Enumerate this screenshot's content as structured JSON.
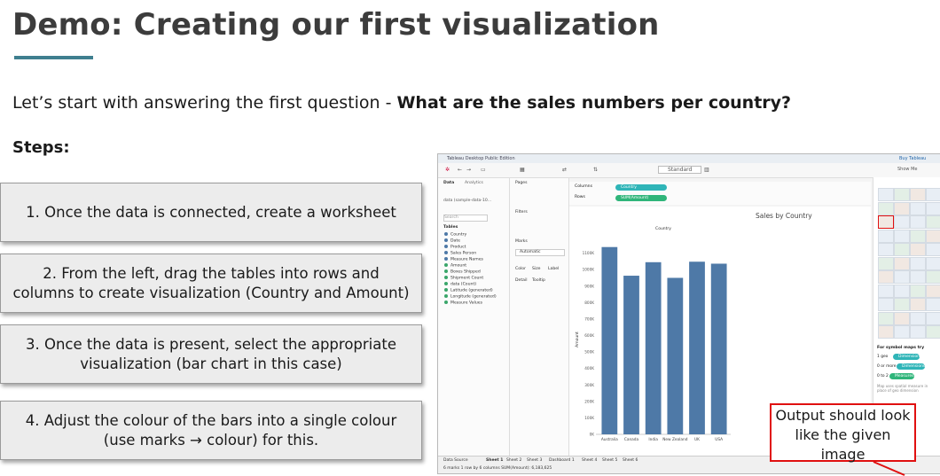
{
  "slide": {
    "title": "Demo: Creating our first visualization",
    "intro_plain": "Let’s start with answering the first question - ",
    "intro_bold": "What are the sales numbers per country?",
    "steps_heading": "Steps:",
    "steps": [
      "1. Once the data is connected, create a worksheet",
      "2.  From the left, drag the tables into rows and columns to create visualization (Country and Amount)",
      "3.  Once the data is present, select the appropriate visualization (bar chart in this case)",
      "4. Adjust the colour of the bars into a single colour (use marks → colour) for this."
    ],
    "callout": "Output should look like the given image",
    "colors": {
      "title_rule": "#3f7f8f",
      "callout_border": "#e01010",
      "bar": "#4e79a7"
    }
  },
  "tableau": {
    "window_title": "Tableau Desktop Public Edition",
    "buy_label": "Buy Tableau",
    "fit_label": "Standard",
    "show_me": "Show Me",
    "tab_data": "Data",
    "tab_analytics": "Analytics",
    "datasource": "data (sample-data-10...",
    "search_placeholder": "Search",
    "tables_heading": "Tables",
    "fields": [
      "Country",
      "Date",
      "Product",
      "Sales Person",
      "Measure Names",
      "Amount",
      "Boxes Shipped",
      "Shipment Count",
      "data (Count)",
      "Latitude (generated)",
      "Longitude (generated)",
      "Measure Values"
    ],
    "pages_label": "Pages",
    "filters_label": "Filters",
    "marks_label": "Marks",
    "marks_type": "Automatic",
    "mark_buttons": [
      "Color",
      "Size",
      "Label",
      "Detail",
      "Tooltip"
    ],
    "columns_label": "Columns",
    "rows_label": "Rows",
    "columns_pill": "Country",
    "rows_pill": "SUM(Amount)",
    "show_me_hint_title": "For symbol maps try",
    "show_me_hints": [
      "1 geo",
      "Dimension",
      "0 or more",
      "Dimensions",
      "0 to 2",
      "Measures"
    ],
    "show_me_note": "Map uses spatial measure in place of geo dimension",
    "status": {
      "datasource_tab": "Data Source",
      "sheets": [
        "Sheet 1",
        "Sheet 2",
        "Sheet 3",
        "Dashboard 1",
        "Sheet 4",
        "Sheet 5",
        "Sheet 6"
      ],
      "summary": "6 marks    1 row by 6 columns    SUM(Amount): 6,183,625"
    }
  },
  "chart_data": {
    "type": "bar",
    "title": "Sales by Country",
    "column_header": "Country",
    "ylabel": "Amount",
    "categories": [
      "Australia",
      "Canada",
      "India",
      "New Zealand",
      "UK",
      "USA"
    ],
    "values": [
      1137,
      963,
      1045,
      950,
      1048,
      1036
    ],
    "ylim": [
      0,
      1200
    ],
    "yticks": [
      "0K",
      "100K",
      "200K",
      "300K",
      "400K",
      "500K",
      "600K",
      "700K",
      "800K",
      "900K",
      "1000K",
      "1100K"
    ],
    "grid": false,
    "legend": "none"
  }
}
